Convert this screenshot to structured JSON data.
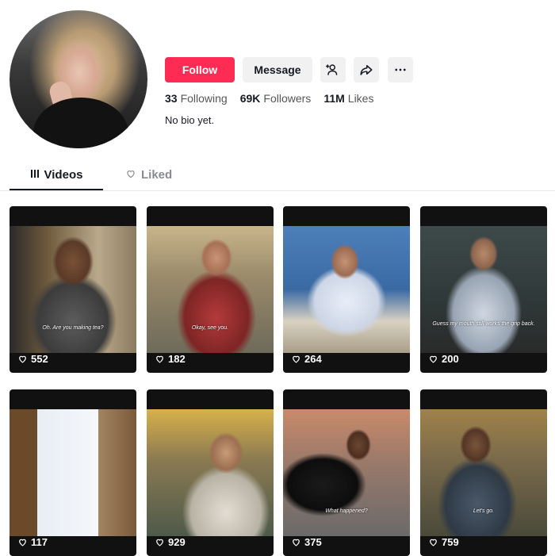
{
  "profile": {
    "follow_label": "Follow",
    "message_label": "Message",
    "stats": [
      {
        "value": "33",
        "label": "Following"
      },
      {
        "value": "69K",
        "label": "Followers"
      },
      {
        "value": "11M",
        "label": "Likes"
      }
    ],
    "bio": "No bio yet."
  },
  "tabs": [
    {
      "label": "Videos",
      "icon": "grid-lines-icon",
      "active": true
    },
    {
      "label": "Liked",
      "icon": "heart-outline-icon",
      "active": false
    }
  ],
  "videos": [
    {
      "likes": "552",
      "caption": "Oh. Are you making tea?"
    },
    {
      "likes": "182",
      "caption": "Okay, see you."
    },
    {
      "likes": "264",
      "caption": ""
    },
    {
      "likes": "200",
      "caption": "Guess my mouth still works the grip back."
    },
    {
      "likes": "117",
      "caption": ""
    },
    {
      "likes": "929",
      "caption": ""
    },
    {
      "likes": "375",
      "caption": "What happened?"
    },
    {
      "likes": "759",
      "caption": "Let's go."
    }
  ],
  "colors": {
    "accent": "#fe2c55",
    "button_bg": "#f1f1f2"
  }
}
